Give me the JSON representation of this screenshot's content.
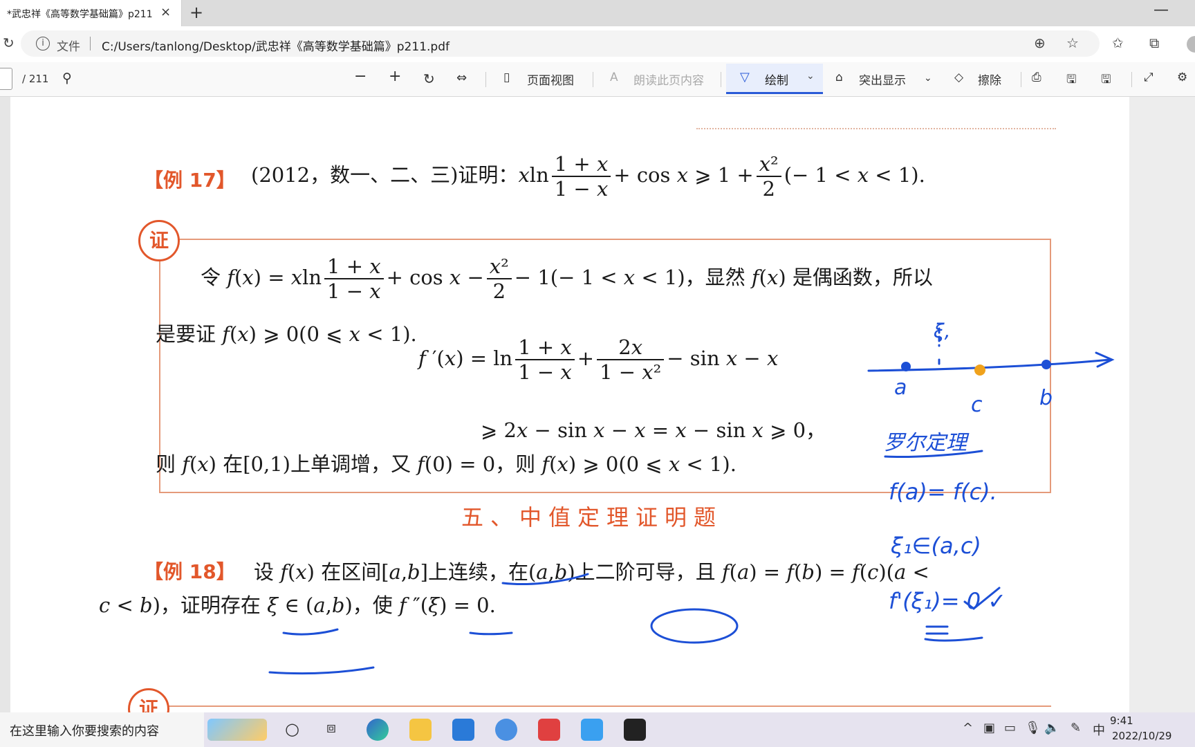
{
  "browser": {
    "tab_title": "*武忠祥《高等数学基础篇》p211",
    "tab_close": "×",
    "new_tab": "+",
    "window_minimize": "—",
    "address_label": "文件",
    "url": "C:/Users/tanlong/Desktop/武忠祥《高等数学基础篇》p211.pdf"
  },
  "pdf_toolbar": {
    "page_total": "/ 211",
    "page_view": "页面视图",
    "read_aloud": "朗读此页内容",
    "draw": "绘制",
    "highlight": "突出显示",
    "erase": "擦除"
  },
  "document": {
    "ex17_label": "【例 17】",
    "ex17_source": "(2012，数一、二、三)证明：",
    "proof_seal": "证",
    "line1_prefix": "令",
    "line1_suffix": "，显然",
    "line1_even": "是偶函数，所以",
    "line2": "是要证",
    "line5": "则",
    "line5_mid": "在[0,1)上单调增，又",
    "line5_end": "，则",
    "section_title": "五、中值定理证明题",
    "ex18_label": "【例 18】",
    "ex18_line1_a": "设",
    "ex18_line1_b": "在区间[",
    "ex18_line1_c": "]上连续，在(",
    "ex18_line1_d": ")上二阶可导，且",
    "ex18_line2_a": "，证明存在",
    "ex18_line2_b": "，使"
  },
  "handwriting": {
    "labels": [
      "ξ,",
      "a",
      "c",
      "b",
      "罗尔定理",
      "f(a)= f(c).",
      "ξ₁∈(a,c)",
      "f'(ξ₁)= 0 ✓"
    ]
  },
  "taskbar": {
    "search_placeholder": "在这里输入你要搜索的内容",
    "time": "9:41",
    "date": "2022/10/29",
    "ime": "中"
  }
}
